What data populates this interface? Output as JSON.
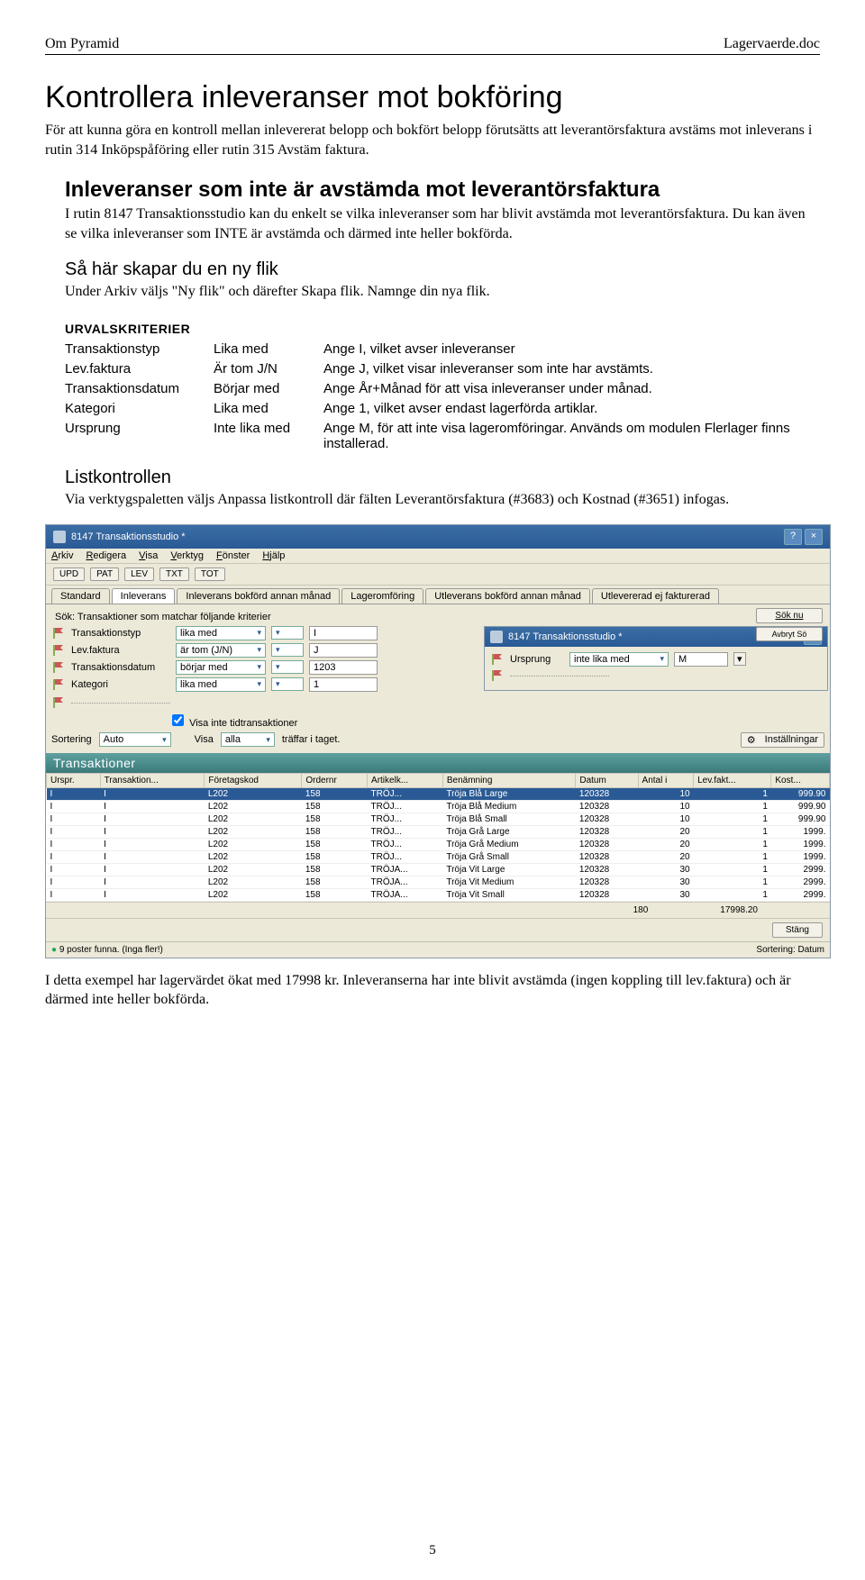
{
  "header": {
    "left": "Om Pyramid",
    "right": "Lagervaerde.doc"
  },
  "h1": "Kontrollera inleveranser mot bokföring",
  "p1": "För att kunna göra en kontroll mellan inlevererat belopp och bokfört belopp förutsätts att leverantörsfaktura avstäms mot inleverans i rutin 314 Inköpspåföring eller rutin 315 Avstäm faktura.",
  "h2": "Inleveranser som inte är avstämda mot leverantörsfaktura",
  "p2": "I rutin 8147 Transaktionsstudio kan du enkelt se vilka inleveranser som har blivit avstämda mot leverantörsfaktura. Du kan även se vilka inleveranser som INTE är avstämda och därmed inte heller bokförda.",
  "h3a": "Så här skapar du en ny flik",
  "p3": "Under Arkiv väljs \"Ny flik\" och därefter Skapa flik. Namnge din nya flik.",
  "h4": "URVALSKRITERIER",
  "crit": [
    {
      "a": "Transaktionstyp",
      "b": "Lika med",
      "c": "Ange I, vilket avser inleveranser"
    },
    {
      "a": "Lev.faktura",
      "b": "Är tom J/N",
      "c": "Ange J, vilket visar inleveranser som inte har avstämts."
    },
    {
      "a": "Transaktionsdatum",
      "b": "Börjar med",
      "c": "Ange År+Månad för att visa inleveranser under månad."
    },
    {
      "a": "Kategori",
      "b": "Lika med",
      "c": "Ange 1, vilket avser endast lagerförda artiklar."
    },
    {
      "a": "Ursprung",
      "b": "Inte lika med",
      "c": "Ange M, för att inte visa lageromföringar. Används om modulen Flerlager finns installerad."
    }
  ],
  "h3b": "Listkontrollen",
  "p4": "Via verktygspaletten väljs Anpassa listkontroll där fälten Leverantörsfaktura (#3683) och Kostnad (#3651) infogas.",
  "shot": {
    "title": "8147 Transaktionsstudio *",
    "menu": [
      "Arkiv",
      "Redigera",
      "Visa",
      "Verktyg",
      "Fönster",
      "Hjälp"
    ],
    "toolbtns": [
      "UPD",
      "PAT",
      "LEV",
      "TXT",
      "TOT"
    ],
    "tabs": [
      "Standard",
      "Inleverans",
      "Inleverans bokförd annan månad",
      "Lageromföring",
      "Utleverans bokförd annan månad",
      "Utlevererad ej fakturerad"
    ],
    "searchlbl": "Sök: Transaktioner som matchar följande kriterier",
    "filters": [
      {
        "l": "Transaktionstyp",
        "op": "lika med",
        "v": "I"
      },
      {
        "l": "Lev.faktura",
        "op": "är tom (J/N)",
        "v": "J"
      },
      {
        "l": "Transaktionsdatum",
        "op": "börjar med",
        "v": "1203"
      },
      {
        "l": "Kategori",
        "op": "lika med",
        "v": "1"
      }
    ],
    "float_title": "8147 Transaktionsstudio *",
    "float_filter": {
      "l": "Ursprung",
      "op": "inte lika med",
      "v": "M"
    },
    "chk": "Visa inte tidtransaktioner",
    "sort": {
      "l": "Sortering",
      "v1": "Auto",
      "l2": "Visa",
      "v2": "alla",
      "tail": "träffar i taget."
    },
    "inst": "Inställningar",
    "soknu": "Sök nu",
    "avsok": "Avbryt Sö",
    "gridtitle": "Transaktioner",
    "cols": [
      "Urspr.",
      "Transaktion...",
      "Företagskod",
      "Ordernr",
      "Artikelk...",
      "Benämning",
      "Datum",
      "Antal i",
      "Lev.fakt...",
      "Kost..."
    ],
    "rows": [
      [
        "I",
        "I",
        "L202",
        "158",
        "TRÖJ...",
        "Tröja Blå Large",
        "120328",
        "10",
        "1",
        "999.90"
      ],
      [
        "I",
        "I",
        "L202",
        "158",
        "TRÖJ...",
        "Tröja Blå Medium",
        "120328",
        "10",
        "1",
        "999.90"
      ],
      [
        "I",
        "I",
        "L202",
        "158",
        "TRÖJ...",
        "Tröja Blå Small",
        "120328",
        "10",
        "1",
        "999.90"
      ],
      [
        "I",
        "I",
        "L202",
        "158",
        "TRÖJ...",
        "Tröja Grå Large",
        "120328",
        "20",
        "1",
        "1999."
      ],
      [
        "I",
        "I",
        "L202",
        "158",
        "TRÖJ...",
        "Tröja Grå Medium",
        "120328",
        "20",
        "1",
        "1999."
      ],
      [
        "I",
        "I",
        "L202",
        "158",
        "TRÖJ...",
        "Tröja Grå Small",
        "120328",
        "20",
        "1",
        "1999."
      ],
      [
        "I",
        "I",
        "L202",
        "158",
        "TRÖJA...",
        "Tröja Vit Large",
        "120328",
        "30",
        "1",
        "2999."
      ],
      [
        "I",
        "I",
        "L202",
        "158",
        "TRÖJA...",
        "Tröja Vit Medium",
        "120328",
        "30",
        "1",
        "2999."
      ],
      [
        "I",
        "I",
        "L202",
        "158",
        "TRÖJA...",
        "Tröja Vit Small",
        "120328",
        "30",
        "1",
        "2999."
      ]
    ],
    "totals": {
      "a": "180",
      "b": "17998.20"
    },
    "stang": "Stäng",
    "status": "9 poster funna. (Inga fler!)",
    "status_r": "Sortering: Datum"
  },
  "p5": "I detta exempel har lagervärdet ökat med 17998 kr. Inleveranserna har inte blivit avstämda (ingen koppling till lev.faktura) och är därmed inte heller bokförda.",
  "pagenum": "5"
}
